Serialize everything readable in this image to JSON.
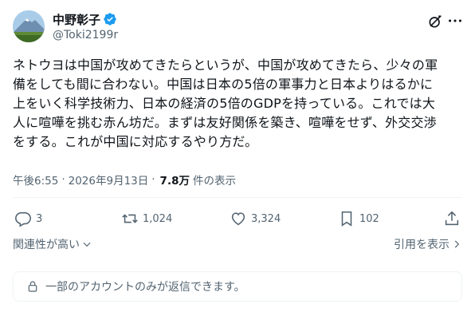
{
  "author": {
    "display_name": "中野彰子",
    "handle": "@Toki2199r",
    "verified": true,
    "avatar_icon": "mountain-landscape-avatar"
  },
  "tweet": {
    "text": "ネトウヨは中国が攻めてきたらというが、中国が攻めてきたら、少々の軍\n備をしても間に合わない。中国は日本の5倍の軍事力と日本よりはるかに\n上をいく科学技術力、日本の経済の5倍のGDPを持っている。これでは大\n人に喧嘩を挑む赤ん坊だ。まずは友好関係を築き、喧嘩をせず、外交交渉\nをする。これが中国に対応するやり方だ。",
    "time": "午後6:55",
    "separator": "·",
    "date": "2026年9月13日",
    "views_count": "7.8万",
    "views_label": "件の表示"
  },
  "actions": {
    "replies": "3",
    "retweets": "1,024",
    "likes": "3,324",
    "bookmarks": "102"
  },
  "sort": {
    "left_label": "関連性が高い",
    "right_label": "引用を表示"
  },
  "reply_restriction": {
    "text": "一部のアカウントのみが返信できます。"
  },
  "colors": {
    "text": "#0f1419",
    "secondary": "#536471",
    "verified": "#1d9bf0",
    "divider": "#eff3f4"
  }
}
